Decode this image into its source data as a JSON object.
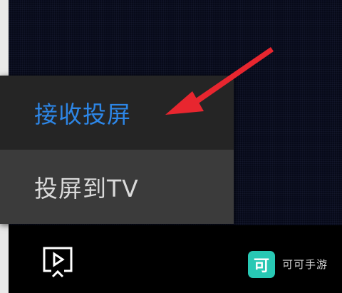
{
  "menu": {
    "items": [
      {
        "label": "接收投屏",
        "color": "#2d86e6",
        "selected": true
      },
      {
        "label": "投屏到TV",
        "color": "#dadada",
        "selected": false
      }
    ]
  },
  "toolbar": {
    "cast_icon": "screen-cast-icon"
  },
  "annotation": {
    "arrow_color": "#e8262f"
  },
  "watermark": {
    "logo_char": "可",
    "text": "可可手游",
    "logo_color": "#28c8b4"
  }
}
